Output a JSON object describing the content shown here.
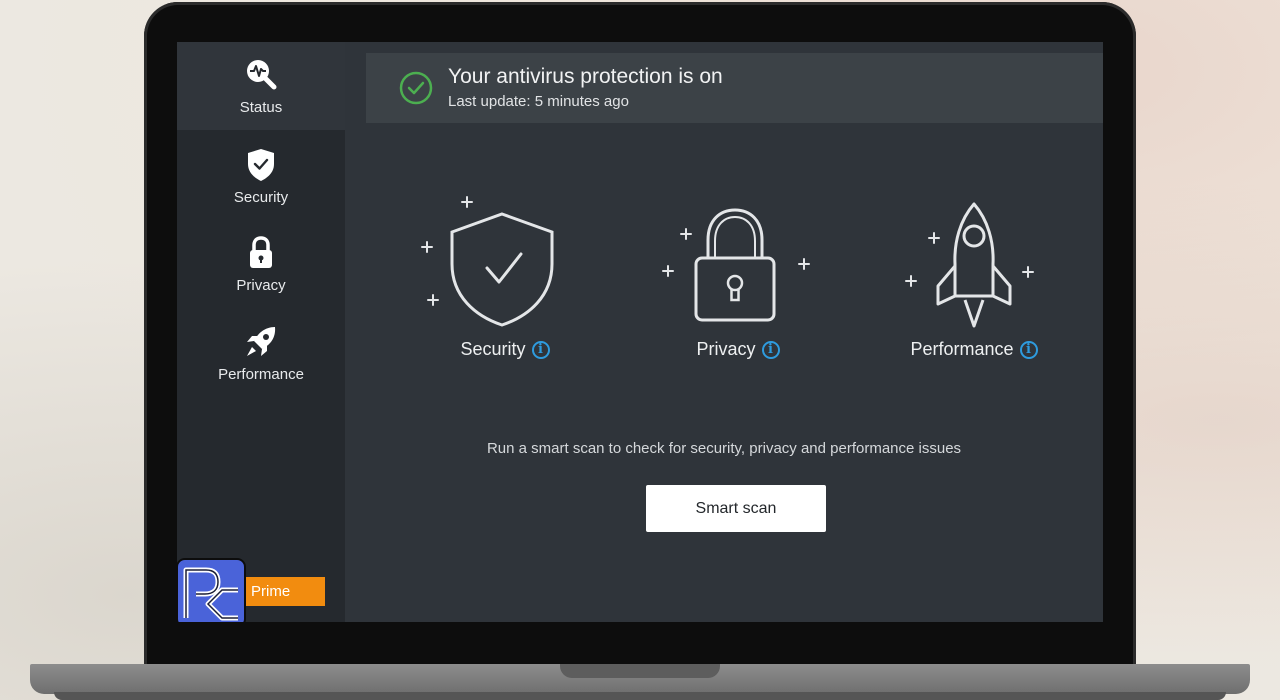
{
  "sidebar": {
    "items": [
      {
        "label": "Status",
        "icon": "status-search-pulse-icon"
      },
      {
        "label": "Security",
        "icon": "shield-check-icon"
      },
      {
        "label": "Privacy",
        "icon": "padlock-icon"
      },
      {
        "label": "Performance",
        "icon": "rocket-icon"
      }
    ],
    "prime_badge": "Prime"
  },
  "status": {
    "title": "Your antivirus protection is on",
    "subtitle": "Last update: 5 minutes ago",
    "icon": "check-circle-icon",
    "accent": "#4caf50"
  },
  "features": [
    {
      "label": "Security",
      "icon": "shield-check-icon"
    },
    {
      "label": "Privacy",
      "icon": "padlock-icon"
    },
    {
      "label": "Performance",
      "icon": "rocket-icon"
    }
  ],
  "info_icon_glyph": "i",
  "scan": {
    "description": "Run a smart scan to check for security, privacy and performance issues",
    "button_label": "Smart scan"
  },
  "colors": {
    "info": "#2e9bde",
    "prime": "#f28c0f",
    "logo": "#4a63d9"
  }
}
